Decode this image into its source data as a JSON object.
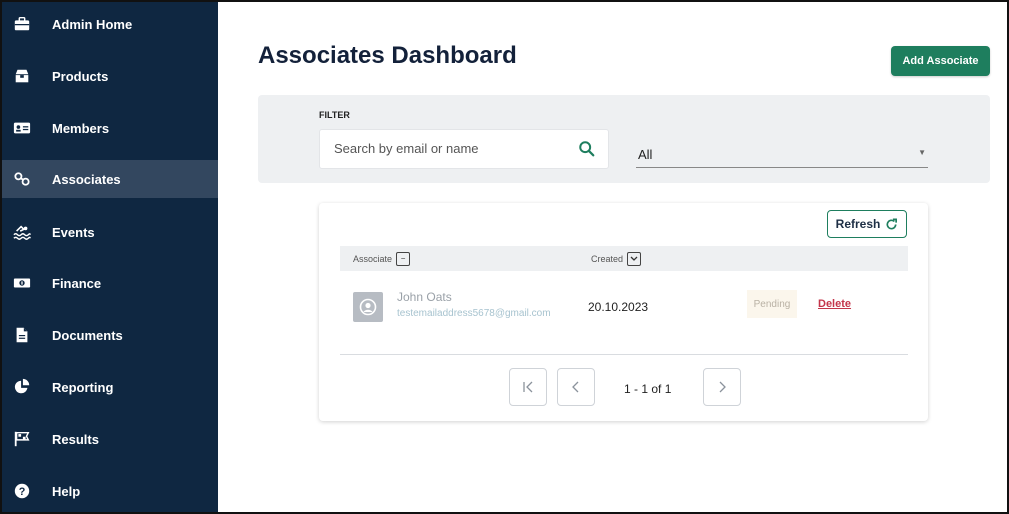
{
  "sidebar": {
    "items": [
      {
        "label": "Admin Home",
        "icon": "briefcase-icon",
        "active": false
      },
      {
        "label": "Products",
        "icon": "product-box-icon",
        "active": false
      },
      {
        "label": "Members",
        "icon": "id-card-icon",
        "active": false
      },
      {
        "label": "Associates",
        "icon": "link-icon",
        "active": true
      },
      {
        "label": "Events",
        "icon": "swimming-icon",
        "active": false
      },
      {
        "label": "Finance",
        "icon": "money-icon",
        "active": false
      },
      {
        "label": "Documents",
        "icon": "document-icon",
        "active": false
      },
      {
        "label": "Reporting",
        "icon": "pie-chart-icon",
        "active": false
      },
      {
        "label": "Results",
        "icon": "checkered-flag-icon",
        "active": false
      },
      {
        "label": "Help",
        "icon": "help-circle-icon",
        "active": false
      }
    ]
  },
  "header": {
    "title": "Associates Dashboard",
    "add_button": "Add Associate"
  },
  "filter": {
    "label": "FILTER",
    "search_placeholder": "Search by email or name",
    "select_value": "All"
  },
  "table": {
    "refresh_label": "Refresh",
    "columns": [
      {
        "label": "Associate",
        "sort_symbol": "−"
      },
      {
        "label": "Created",
        "sort_symbol": "⌄"
      }
    ],
    "rows": [
      {
        "name": "John Oats",
        "email": "testemailaddress5678@gmail.com",
        "created": "20.10.2023",
        "status": "Pending",
        "action": "Delete"
      }
    ]
  },
  "pagination": {
    "text": "1 - 1 of 1"
  },
  "colors": {
    "sidebar_bg": "#0f2741",
    "sidebar_active": "#33475f",
    "accent": "#1e7e5e",
    "delete": "#c4354a"
  }
}
